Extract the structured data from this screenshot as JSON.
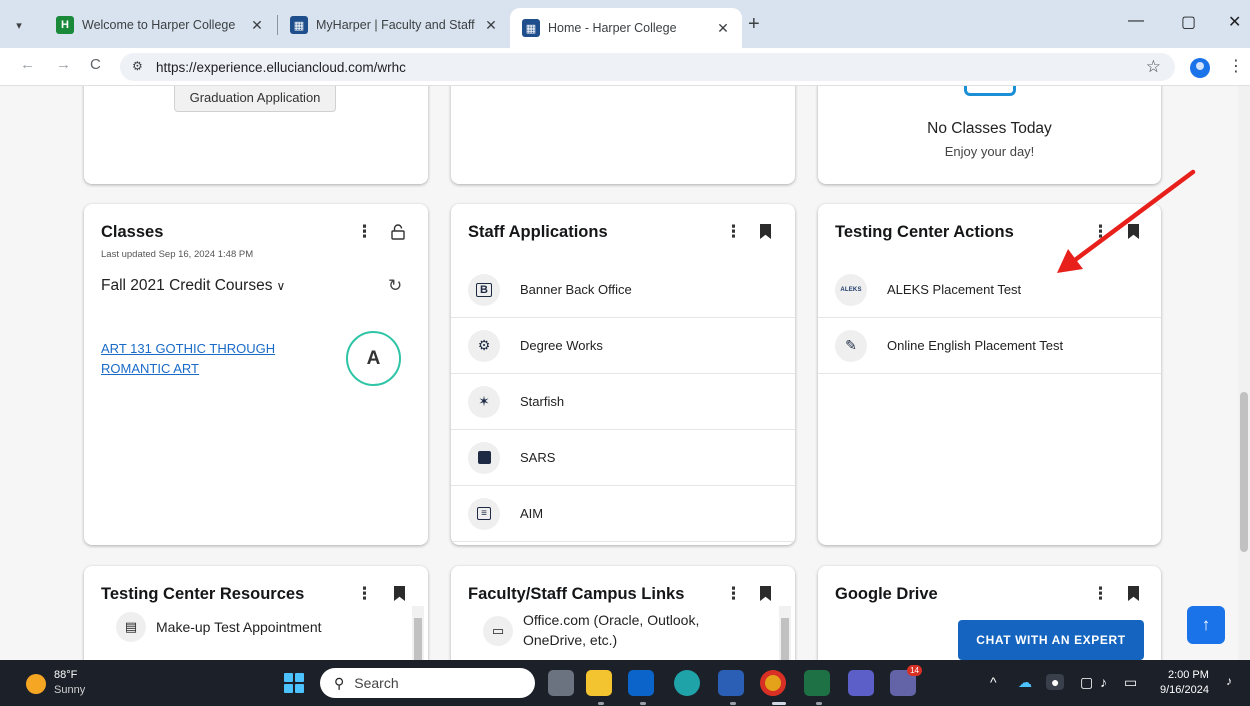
{
  "browser": {
    "tabs": [
      {
        "title": "Welcome to Harper College",
        "active": false
      },
      {
        "title": "MyHarper | Faculty and Staff",
        "active": false
      },
      {
        "title": "Home - Harper College",
        "active": true
      }
    ],
    "url": "https://experience.elluciancloud.com/wrhc"
  },
  "top_cards": {
    "graduation_button": "Graduation Application",
    "no_classes_title": "No Classes Today",
    "no_classes_sub": "Enjoy your day!"
  },
  "classes_card": {
    "title": "Classes",
    "updated": "Last updated Sep 16, 2024 1:48 PM",
    "term": "Fall 2021 Credit Courses",
    "course": "ART 131 GOTHIC THROUGH ROMANTIC ART",
    "grade": "A"
  },
  "staff_apps": {
    "title": "Staff Applications",
    "items": [
      {
        "label": "Banner Back Office",
        "icon": "banner-b-icon"
      },
      {
        "label": "Degree Works",
        "icon": "degree-works-icon"
      },
      {
        "label": "Starfish",
        "icon": "starfish-icon"
      },
      {
        "label": "SARS",
        "icon": "sars-icon"
      },
      {
        "label": "AIM",
        "icon": "aim-icon"
      }
    ]
  },
  "testing_actions": {
    "title": "Testing Center Actions",
    "items": [
      {
        "label": "ALEKS Placement Test",
        "icon_text": "ALEKS"
      },
      {
        "label": "Online English Placement Test",
        "icon": "pen-icon"
      }
    ]
  },
  "testing_resources": {
    "title": "Testing Center Resources",
    "item": "Make-up Test Appointment"
  },
  "campus_links": {
    "title": "Faculty/Staff Campus Links",
    "item": "Office.com (Oracle, Outlook, OneDrive, etc.)"
  },
  "google_drive": {
    "title": "Google Drive"
  },
  "chat_button": "CHAT WITH AN EXPERT",
  "taskbar": {
    "temp": "88°F",
    "weather": "Sunny",
    "search_placeholder": "Search",
    "time": "2:00 PM",
    "date": "9/16/2024",
    "teams_badge": "14"
  },
  "colors": {
    "accent": "#1565c0",
    "arrow": "#e8201c",
    "grade_ring": "#2ec4a6"
  }
}
